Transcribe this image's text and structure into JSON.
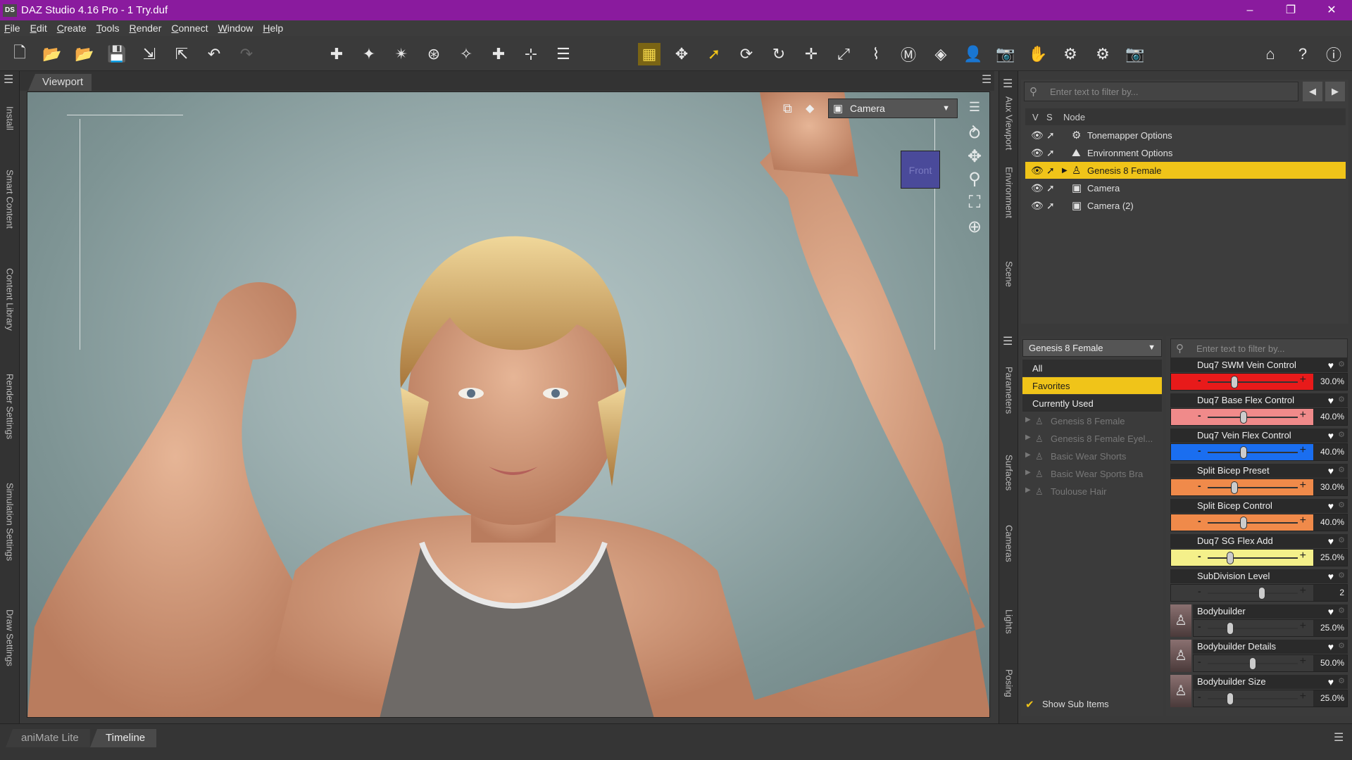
{
  "window": {
    "app_icon": "DS",
    "title": "DAZ Studio 4.16 Pro - 1 Try.duf",
    "controls": [
      "–",
      "❐",
      "✕"
    ]
  },
  "menu": [
    "File",
    "Edit",
    "Create",
    "Tools",
    "Render",
    "Connect",
    "Window",
    "Help"
  ],
  "left_tabs": [
    "Install",
    "Smart Content",
    "Content Library",
    "Render Settings",
    "Simulation Settings",
    "Draw Settings"
  ],
  "viewport": {
    "tab": "Viewport",
    "camera_label": "Camera",
    "gizmo_label": "Front"
  },
  "mid_tabs": [
    "Aux Viewport",
    "Environment",
    "Scene",
    "Parameters",
    "Surfaces",
    "Cameras",
    "Lights",
    "Posing"
  ],
  "scene": {
    "filter_placeholder": "Enter text to filter by...",
    "col_v": "V",
    "col_s": "S",
    "col_node": "Node",
    "nodes": [
      {
        "label": "Tonemapper Options",
        "selected": false
      },
      {
        "label": "Environment Options",
        "selected": false
      },
      {
        "label": "Genesis 8 Female",
        "selected": true
      },
      {
        "label": "Camera",
        "selected": false
      },
      {
        "label": "Camera (2)",
        "selected": false
      }
    ]
  },
  "parameters": {
    "figure": "Genesis 8 Female",
    "filter_placeholder": "Enter text to filter by...",
    "categories": [
      {
        "label": "All"
      },
      {
        "label": "Favorites"
      },
      {
        "label": "Currently Used"
      },
      {
        "label": "Genesis 8 Female"
      },
      {
        "label": "Genesis 8 Female Eyel..."
      },
      {
        "label": "Basic Wear Shorts"
      },
      {
        "label": "Basic Wear Sports Bra"
      },
      {
        "label": "Toulouse Hair"
      }
    ],
    "show_sub_items": "Show Sub Items",
    "sliders": [
      {
        "name": "Duq7 SWM Vein Control",
        "value": "30.0%",
        "level": 0.3,
        "color": "#e81a1a"
      },
      {
        "name": "Duq7 Base Flex Control",
        "value": "40.0%",
        "level": 0.4,
        "color": "#f08a8a"
      },
      {
        "name": "Duq7 Vein Flex Control",
        "value": "40.0%",
        "level": 0.4,
        "color": "#1a6ef0"
      },
      {
        "name": "Split Bicep Preset",
        "value": "30.0%",
        "level": 0.3,
        "color": "#f08a4a"
      },
      {
        "name": "Split Bicep Control",
        "value": "40.0%",
        "level": 0.4,
        "color": "#f08a4a"
      },
      {
        "name": "Duq7 SG Flex Add",
        "value": "25.0%",
        "level": 0.25,
        "color": "#f4f08a"
      },
      {
        "name": "SubDivision Level",
        "value": "2",
        "level": 0.6,
        "color": "#3a3a3a"
      },
      {
        "name": "Bodybuilder",
        "value": "25.0%",
        "level": 0.25,
        "color": "#3a3a3a"
      },
      {
        "name": "Bodybuilder Details",
        "value": "50.0%",
        "level": 0.5,
        "color": "#3a3a3a"
      },
      {
        "name": "Bodybuilder Size",
        "value": "25.0%",
        "level": 0.25,
        "color": "#3a3a3a"
      }
    ]
  },
  "bottom_tabs": [
    {
      "label": "aniMate Lite",
      "active": false
    },
    {
      "label": "Timeline",
      "active": true
    }
  ]
}
